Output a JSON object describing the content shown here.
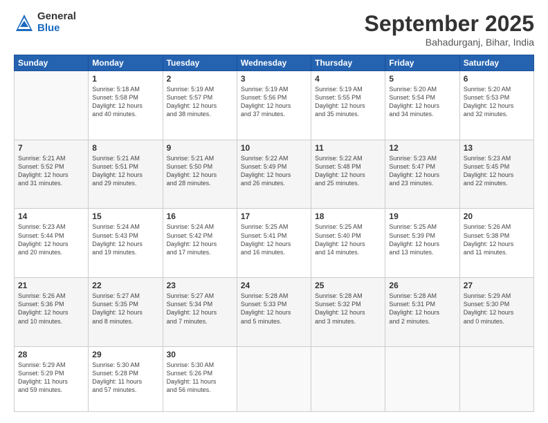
{
  "logo": {
    "general": "General",
    "blue": "Blue"
  },
  "title": "September 2025",
  "location": "Bahadurganj, Bihar, India",
  "days_of_week": [
    "Sunday",
    "Monday",
    "Tuesday",
    "Wednesday",
    "Thursday",
    "Friday",
    "Saturday"
  ],
  "weeks": [
    [
      {
        "day": "",
        "info": ""
      },
      {
        "day": "1",
        "info": "Sunrise: 5:18 AM\nSunset: 5:58 PM\nDaylight: 12 hours\nand 40 minutes."
      },
      {
        "day": "2",
        "info": "Sunrise: 5:19 AM\nSunset: 5:57 PM\nDaylight: 12 hours\nand 38 minutes."
      },
      {
        "day": "3",
        "info": "Sunrise: 5:19 AM\nSunset: 5:56 PM\nDaylight: 12 hours\nand 37 minutes."
      },
      {
        "day": "4",
        "info": "Sunrise: 5:19 AM\nSunset: 5:55 PM\nDaylight: 12 hours\nand 35 minutes."
      },
      {
        "day": "5",
        "info": "Sunrise: 5:20 AM\nSunset: 5:54 PM\nDaylight: 12 hours\nand 34 minutes."
      },
      {
        "day": "6",
        "info": "Sunrise: 5:20 AM\nSunset: 5:53 PM\nDaylight: 12 hours\nand 32 minutes."
      }
    ],
    [
      {
        "day": "7",
        "info": "Sunrise: 5:21 AM\nSunset: 5:52 PM\nDaylight: 12 hours\nand 31 minutes."
      },
      {
        "day": "8",
        "info": "Sunrise: 5:21 AM\nSunset: 5:51 PM\nDaylight: 12 hours\nand 29 minutes."
      },
      {
        "day": "9",
        "info": "Sunrise: 5:21 AM\nSunset: 5:50 PM\nDaylight: 12 hours\nand 28 minutes."
      },
      {
        "day": "10",
        "info": "Sunrise: 5:22 AM\nSunset: 5:49 PM\nDaylight: 12 hours\nand 26 minutes."
      },
      {
        "day": "11",
        "info": "Sunrise: 5:22 AM\nSunset: 5:48 PM\nDaylight: 12 hours\nand 25 minutes."
      },
      {
        "day": "12",
        "info": "Sunrise: 5:23 AM\nSunset: 5:47 PM\nDaylight: 12 hours\nand 23 minutes."
      },
      {
        "day": "13",
        "info": "Sunrise: 5:23 AM\nSunset: 5:45 PM\nDaylight: 12 hours\nand 22 minutes."
      }
    ],
    [
      {
        "day": "14",
        "info": "Sunrise: 5:23 AM\nSunset: 5:44 PM\nDaylight: 12 hours\nand 20 minutes."
      },
      {
        "day": "15",
        "info": "Sunrise: 5:24 AM\nSunset: 5:43 PM\nDaylight: 12 hours\nand 19 minutes."
      },
      {
        "day": "16",
        "info": "Sunrise: 5:24 AM\nSunset: 5:42 PM\nDaylight: 12 hours\nand 17 minutes."
      },
      {
        "day": "17",
        "info": "Sunrise: 5:25 AM\nSunset: 5:41 PM\nDaylight: 12 hours\nand 16 minutes."
      },
      {
        "day": "18",
        "info": "Sunrise: 5:25 AM\nSunset: 5:40 PM\nDaylight: 12 hours\nand 14 minutes."
      },
      {
        "day": "19",
        "info": "Sunrise: 5:25 AM\nSunset: 5:39 PM\nDaylight: 12 hours\nand 13 minutes."
      },
      {
        "day": "20",
        "info": "Sunrise: 5:26 AM\nSunset: 5:38 PM\nDaylight: 12 hours\nand 11 minutes."
      }
    ],
    [
      {
        "day": "21",
        "info": "Sunrise: 5:26 AM\nSunset: 5:36 PM\nDaylight: 12 hours\nand 10 minutes."
      },
      {
        "day": "22",
        "info": "Sunrise: 5:27 AM\nSunset: 5:35 PM\nDaylight: 12 hours\nand 8 minutes."
      },
      {
        "day": "23",
        "info": "Sunrise: 5:27 AM\nSunset: 5:34 PM\nDaylight: 12 hours\nand 7 minutes."
      },
      {
        "day": "24",
        "info": "Sunrise: 5:28 AM\nSunset: 5:33 PM\nDaylight: 12 hours\nand 5 minutes."
      },
      {
        "day": "25",
        "info": "Sunrise: 5:28 AM\nSunset: 5:32 PM\nDaylight: 12 hours\nand 3 minutes."
      },
      {
        "day": "26",
        "info": "Sunrise: 5:28 AM\nSunset: 5:31 PM\nDaylight: 12 hours\nand 2 minutes."
      },
      {
        "day": "27",
        "info": "Sunrise: 5:29 AM\nSunset: 5:30 PM\nDaylight: 12 hours\nand 0 minutes."
      }
    ],
    [
      {
        "day": "28",
        "info": "Sunrise: 5:29 AM\nSunset: 5:29 PM\nDaylight: 11 hours\nand 59 minutes."
      },
      {
        "day": "29",
        "info": "Sunrise: 5:30 AM\nSunset: 5:28 PM\nDaylight: 11 hours\nand 57 minutes."
      },
      {
        "day": "30",
        "info": "Sunrise: 5:30 AM\nSunset: 5:26 PM\nDaylight: 11 hours\nand 56 minutes."
      },
      {
        "day": "",
        "info": ""
      },
      {
        "day": "",
        "info": ""
      },
      {
        "day": "",
        "info": ""
      },
      {
        "day": "",
        "info": ""
      }
    ]
  ]
}
